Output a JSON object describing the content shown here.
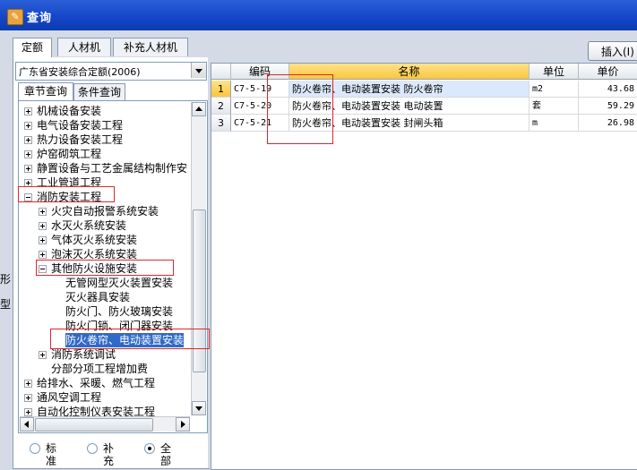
{
  "window": {
    "title": "查询"
  },
  "top_tabs": [
    {
      "label": "定额",
      "active": true
    },
    {
      "label": "人材机",
      "active": false
    },
    {
      "label": "补充人材机",
      "active": false
    }
  ],
  "insert_button": "插入(I)",
  "left": {
    "combo_value": "广东省安装综合定额(2006)",
    "subtabs": [
      {
        "label": "章节查询",
        "active": true
      },
      {
        "label": "条件查询",
        "active": false
      }
    ],
    "tree": [
      {
        "label": "机械设备安装",
        "level": 0,
        "expander": "plus"
      },
      {
        "label": "电气设备安装工程",
        "level": 0,
        "expander": "plus"
      },
      {
        "label": "热力设备安装工程",
        "level": 0,
        "expander": "plus"
      },
      {
        "label": "炉窑砌筑工程",
        "level": 0,
        "expander": "plus"
      },
      {
        "label": "静置设备与工艺金属结构制作安",
        "level": 0,
        "expander": "plus"
      },
      {
        "label": "工业管道工程",
        "level": 0,
        "expander": "plus"
      },
      {
        "label": "消防安装工程",
        "level": 0,
        "expander": "minus"
      },
      {
        "label": "火灾自动报警系统安装",
        "level": 1,
        "expander": "plus"
      },
      {
        "label": "水灭火系统安装",
        "level": 1,
        "expander": "plus"
      },
      {
        "label": "气体灭火系统安装",
        "level": 1,
        "expander": "plus"
      },
      {
        "label": "泡沫灭火系统安装",
        "level": 1,
        "expander": "plus"
      },
      {
        "label": "其他防火设施安装",
        "level": 1,
        "expander": "minus"
      },
      {
        "label": "无管网型灭火装置安装",
        "level": 2,
        "expander": "none"
      },
      {
        "label": "灭火器具安装",
        "level": 2,
        "expander": "none"
      },
      {
        "label": "防火门、防火玻璃安装",
        "level": 2,
        "expander": "none"
      },
      {
        "label": "防火门锁、闭门器安装",
        "level": 2,
        "expander": "none"
      },
      {
        "label": "防火卷帘、电动装置安装",
        "level": 2,
        "expander": "none",
        "selected": true
      },
      {
        "label": "消防系统调试",
        "level": 1,
        "expander": "plus"
      },
      {
        "label": "分部分项工程增加费",
        "level": 1,
        "expander": "none"
      },
      {
        "label": "给排水、采暖、燃气工程",
        "level": 0,
        "expander": "plus"
      },
      {
        "label": "通风空调工程",
        "level": 0,
        "expander": "plus"
      },
      {
        "label": "自动化控制仪表安装工程",
        "level": 0,
        "expander": "plus"
      }
    ],
    "radios": [
      {
        "label": "标准",
        "checked": false
      },
      {
        "label": "补充",
        "checked": false
      },
      {
        "label": "全部",
        "checked": true
      }
    ],
    "edge_text": [
      "形",
      "型"
    ]
  },
  "grid": {
    "headers": {
      "code": "编码",
      "name": "名称",
      "unit": "单位",
      "price": "单价"
    },
    "rows": [
      {
        "no": "1",
        "code": "C7-5-19",
        "name": "防火卷帘、电动装置安装 防火卷帘",
        "unit": "m2",
        "price": "43.68"
      },
      {
        "no": "2",
        "code": "C7-5-20",
        "name": "防火卷帘、电动装置安装 电动装置",
        "unit": "套",
        "price": "59.29"
      },
      {
        "no": "3",
        "code": "C7-5-21",
        "name": "防火卷帘、电动装置安装 封闸头箱",
        "unit": "m",
        "price": "26.98"
      }
    ]
  },
  "colors": {
    "titlebar": "#1547c8",
    "selection": "#3169c6",
    "annotation": "#e0262b",
    "header_highlight": "#f9c63e"
  }
}
